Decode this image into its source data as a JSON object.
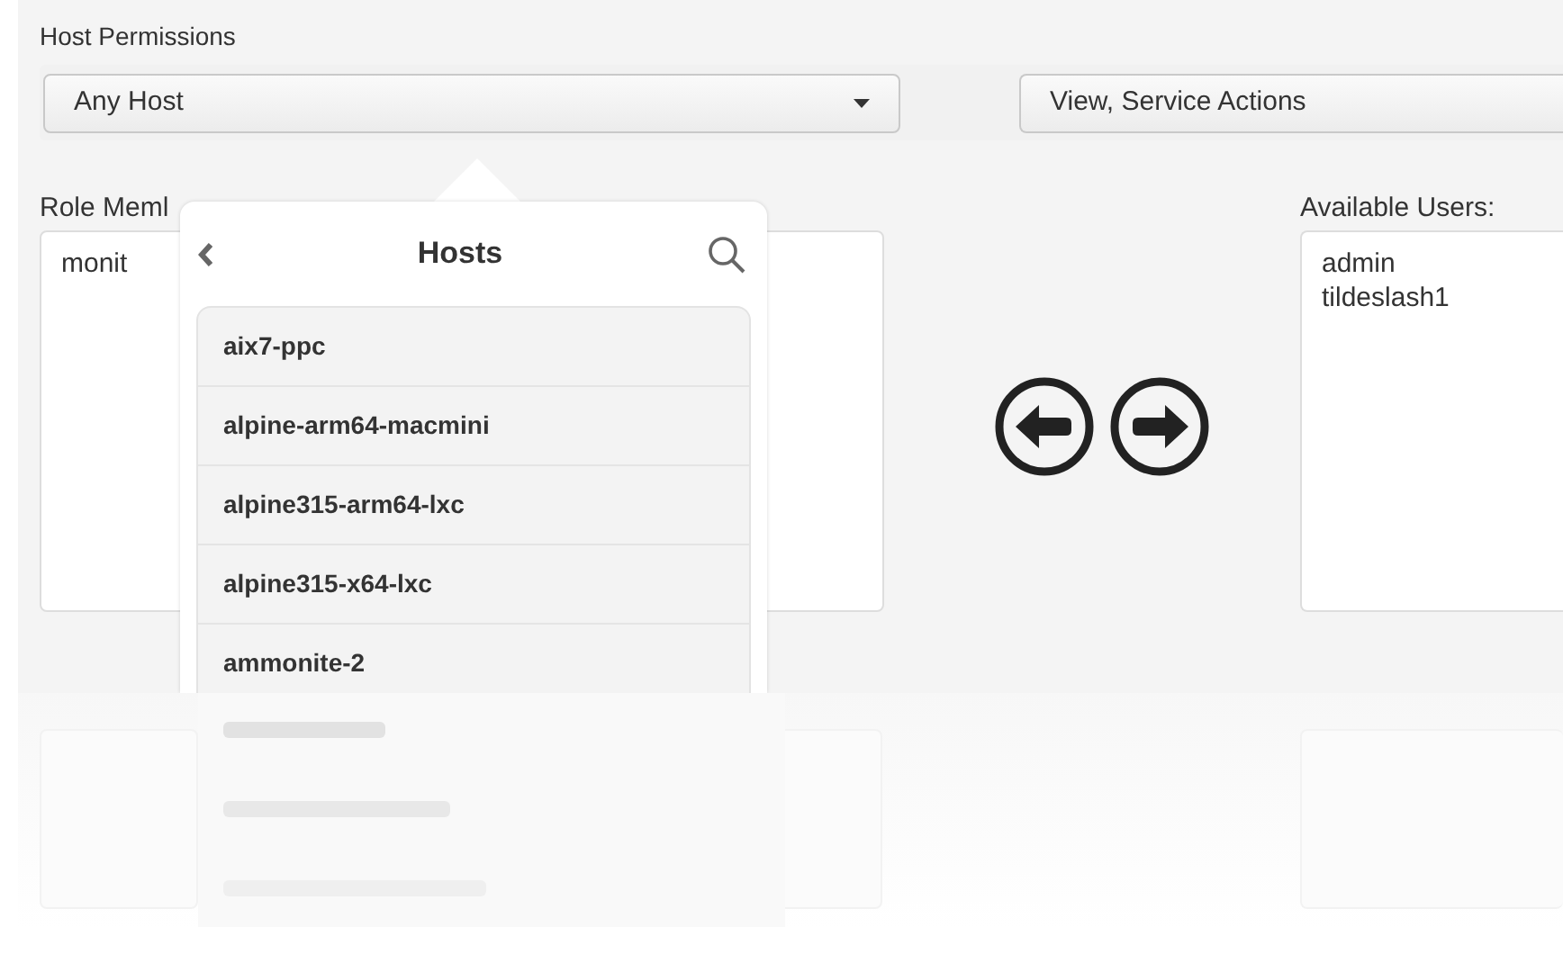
{
  "section_title": "Host Permissions",
  "host_select": {
    "value": "Any Host"
  },
  "actions_select": {
    "value": "View, Service Actions"
  },
  "role_members": {
    "label": "Role Meml",
    "users": [
      "monit"
    ]
  },
  "available_users": {
    "label": "Available Users:",
    "users": [
      "admin",
      "tildeslash1"
    ]
  },
  "hosts_popover": {
    "title": "Hosts",
    "hosts": [
      {
        "name": "aix7-ppc"
      },
      {
        "name": "alpine-arm64-macmini"
      },
      {
        "name": "alpine315-arm64-lxc"
      },
      {
        "name": "alpine315-x64-lxc"
      },
      {
        "name": "ammonite-2"
      }
    ]
  }
}
